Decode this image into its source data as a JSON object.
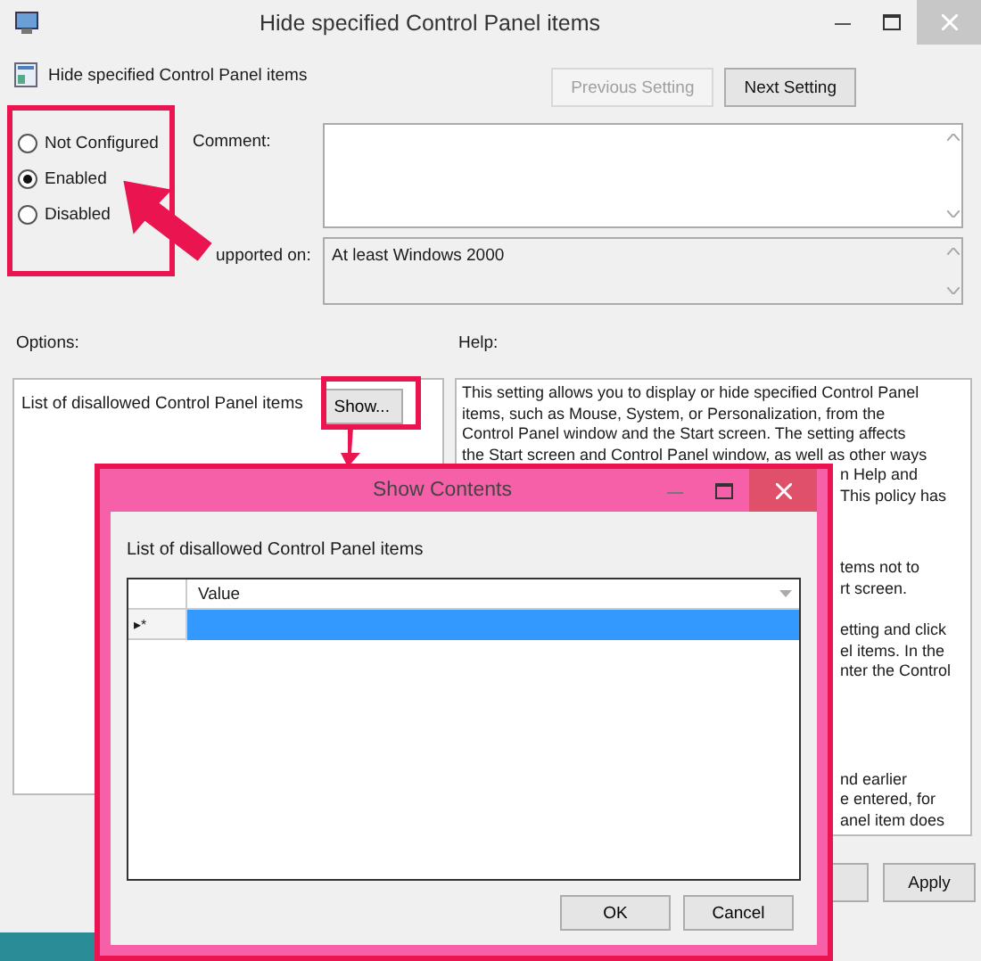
{
  "window": {
    "title": "Hide specified Control Panel items"
  },
  "header": {
    "title": "Hide specified Control Panel items",
    "buttons": [
      {
        "label": "Previous Setting",
        "disabled": true
      },
      {
        "label": "Next Setting",
        "disabled": false
      }
    ]
  },
  "state_options": [
    {
      "label": "Not Configured",
      "selected": false
    },
    {
      "label": "Enabled",
      "selected": true
    },
    {
      "label": "Disabled",
      "selected": false
    }
  ],
  "comment": {
    "label": "Comment:"
  },
  "supported_on": {
    "label": "upported on:",
    "value": "At least Windows 2000"
  },
  "options": {
    "label": "Options:",
    "item_label": "List of disallowed Control Panel items",
    "button": "Show..."
  },
  "help": {
    "label": "Help:",
    "blocks": [
      [
        "This setting allows you to display or hide specified Control Panel",
        "items, such as Mouse, System, or Personalization, from the",
        "Control Panel window and the Start screen. The setting affects",
        "the Start screen and Control Panel window, as well as other ways"
      ],
      [
        "n Help and",
        "This policy has"
      ],
      [
        "tems not to",
        "rt screen."
      ],
      [
        "etting and click",
        "el items. In the",
        "nter the Control"
      ],
      [
        "nd earlier",
        "e entered, for",
        "anel item does"
      ]
    ]
  },
  "footer_buttons": [
    "Apply"
  ],
  "dialog": {
    "title": "Show Contents",
    "label": "List of disallowed Control Panel items",
    "columns": [
      "Value"
    ],
    "rows": [
      {
        "marker": "▸*",
        "selected": true
      }
    ],
    "buttons": [
      "OK",
      "Cancel"
    ]
  }
}
